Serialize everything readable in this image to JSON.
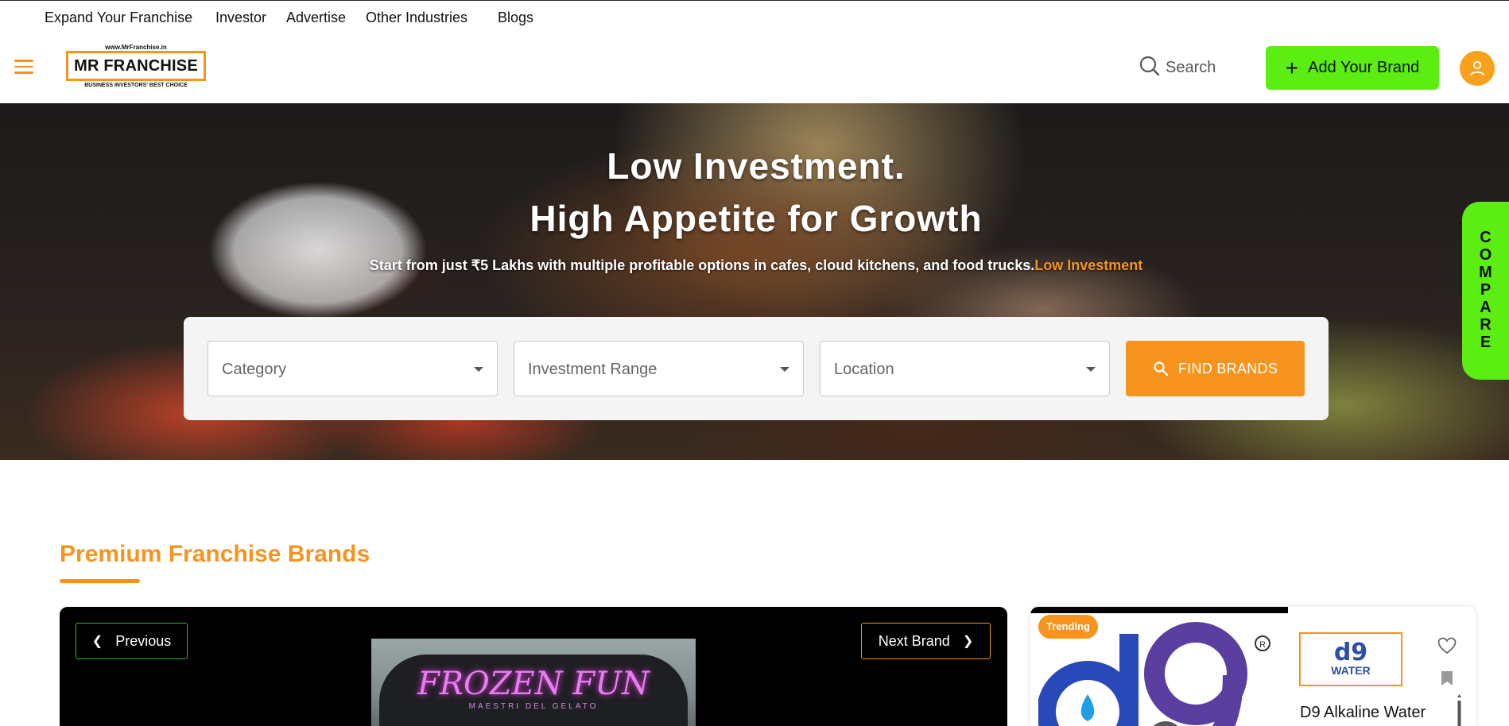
{
  "top_nav": {
    "links": [
      "Expand Your Franchise",
      "Investor",
      "Advertise",
      "Other Industries",
      "Blogs"
    ]
  },
  "header": {
    "logo": {
      "url_text": "www.MrFranchise.in",
      "name": "MR FRANCHISE",
      "tagline": "BUSINESS INVESTORS' BEST CHOICE"
    },
    "search_label": "Search",
    "add_brand_label": "Add Your Brand",
    "icons": [
      "hamburger-icon",
      "search-icon",
      "plus-icon",
      "user-icon"
    ]
  },
  "hero": {
    "title_line1": "Low Investment.",
    "title_line2": "High Appetite for Growth",
    "subtitle": "Start from just ₹5 Lakhs with multiple profitable options in cafes, cloud kitchens, and food trucks.",
    "subtitle_highlight": "Low Investment",
    "filters": {
      "category": "Category",
      "investment_range": "Investment Range",
      "location": "Location"
    },
    "find_label": "FIND BRANDS"
  },
  "compare": {
    "letters": [
      "C",
      "O",
      "M",
      "P",
      "A",
      "R",
      "E"
    ]
  },
  "premium": {
    "title": "Premium Franchise Brands",
    "prev_label": "Previous",
    "next_label": "Next Brand",
    "slide": {
      "brand": "FROZEN FUN",
      "sub": "MAESTRI DEL GELATO"
    },
    "card": {
      "badge": "Trending",
      "logo_text": "d9",
      "logo_sub": "WATER",
      "name": "D9 Alkaline Water"
    }
  },
  "colors": {
    "accent_orange": "#f7941d",
    "accent_green": "#5ced12",
    "text_dark": "#111111"
  }
}
